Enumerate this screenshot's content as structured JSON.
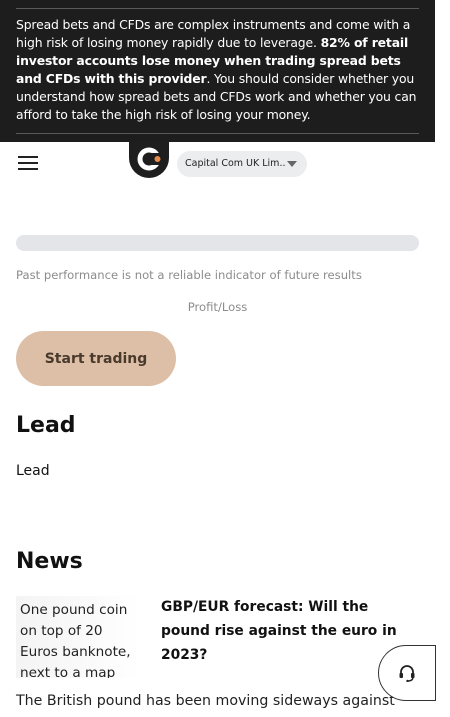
{
  "risk_warning": {
    "part1": "Spread bets and CFDs are complex instruments and come with a high risk of losing money rapidly due to leverage. ",
    "bold": "82% of retail investor accounts lose money when trading spread bets and CFDs with this provider",
    "part2": ". You should consider whether you understand how spread bets and CFDs work and whether you can afford to take the high risk of losing your money."
  },
  "header": {
    "menu_icon": "hamburger-menu-icon",
    "logo_icon": "capital-com-logo",
    "entity_select": {
      "value": "Capital Com UK Lim..."
    }
  },
  "main": {
    "disclaimer": "Past performance is not a reliable indicator of future results",
    "profit_loss_label": "Profit/Loss",
    "cta_label": "Start trading"
  },
  "lead": {
    "title": "Lead",
    "text": "Lead"
  },
  "news": {
    "title": "News",
    "items": [
      {
        "image_alt": "One pound coin on top of 20 Euros banknote, next to a map",
        "headline": "GBP/EUR forecast: Will the pound rise against the euro in 2023?",
        "excerpt": "The British pound has been moving sideways against"
      }
    ]
  },
  "support": {
    "icon": "headset-icon"
  },
  "colors": {
    "banner_bg": "#1d1d1d",
    "cta_bg": "#dcbfa6",
    "skeleton": "#e4e5e8",
    "muted_text": "#8c8c8c"
  }
}
